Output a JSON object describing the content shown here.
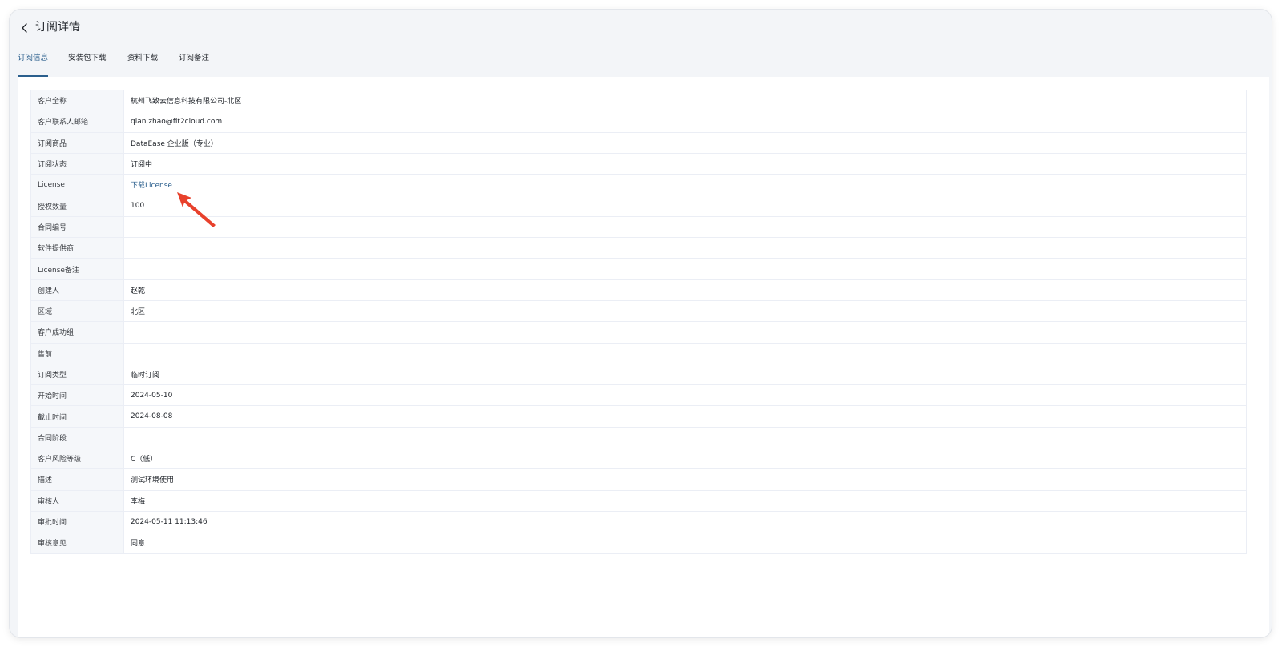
{
  "header": {
    "title": "订阅详情"
  },
  "tabs": [
    {
      "label": "订阅信息",
      "active": true
    },
    {
      "label": "安装包下载",
      "active": false
    },
    {
      "label": "资料下载",
      "active": false
    },
    {
      "label": "订阅备注",
      "active": false
    }
  ],
  "details": {
    "rows": [
      {
        "label": "客户全称",
        "value": "杭州飞致云信息科技有限公司-北区"
      },
      {
        "label": "客户联系人邮箱",
        "value": "qian.zhao@fit2cloud.com"
      },
      {
        "label": "订阅商品",
        "value": "DataEase 企业版（专业）"
      },
      {
        "label": "订阅状态",
        "value": "订阅中"
      },
      {
        "label": "License",
        "value": "下载License"
      },
      {
        "label": "授权数量",
        "value": "100"
      },
      {
        "label": "合同编号",
        "value": ""
      },
      {
        "label": "软件提供商",
        "value": ""
      },
      {
        "label": "License备注",
        "value": ""
      },
      {
        "label": "创建人",
        "value": "赵乾"
      },
      {
        "label": "区域",
        "value": "北区"
      },
      {
        "label": "客户成功组",
        "value": ""
      },
      {
        "label": "售前",
        "value": ""
      },
      {
        "label": "订阅类型",
        "value": "临时订阅"
      },
      {
        "label": "开始时间",
        "value": "2024-05-10"
      },
      {
        "label": "截止时间",
        "value": "2024-08-08"
      },
      {
        "label": "合同阶段",
        "value": ""
      },
      {
        "label": "客户风险等级",
        "value": "C（低）"
      },
      {
        "label": "描述",
        "value": "测试环境使用"
      },
      {
        "label": "审核人",
        "value": "李梅"
      },
      {
        "label": "审批时间",
        "value": "2024-05-11 11:13:46"
      },
      {
        "label": "审核意见",
        "value": "同意"
      }
    ]
  },
  "colors": {
    "accent": "#2b5f8d",
    "annotation_arrow": "#e8412c"
  },
  "icons": {
    "back": "chevron-left-icon",
    "annotation": "red-arrow-pointer"
  }
}
